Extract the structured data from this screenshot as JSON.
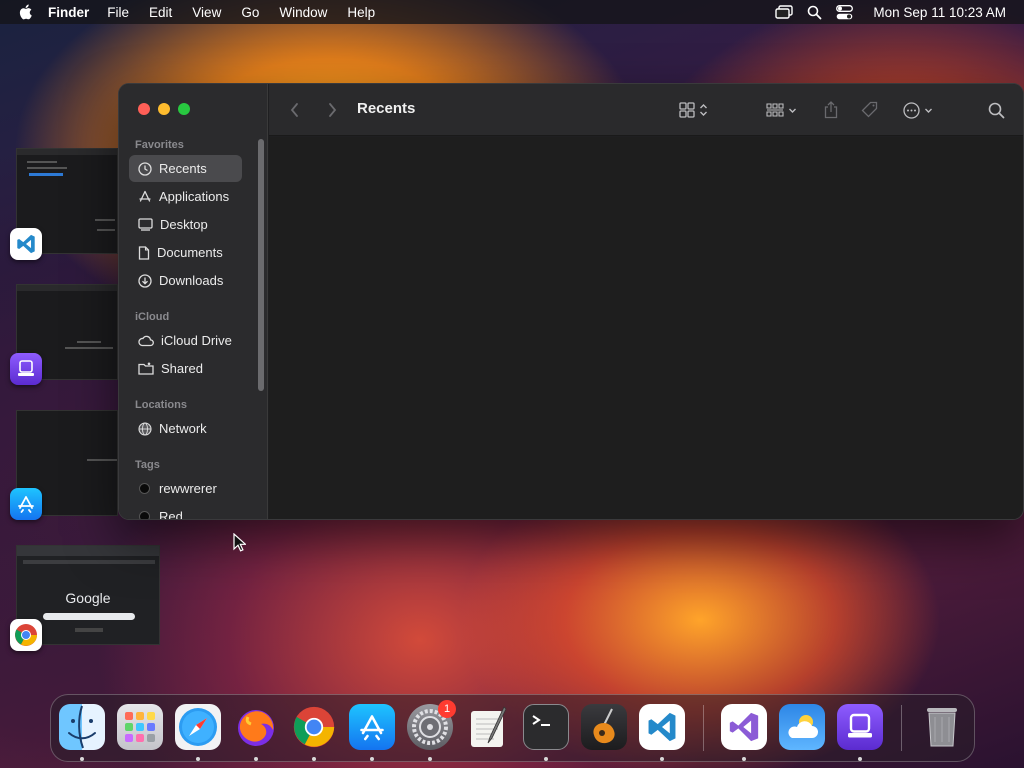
{
  "menubar": {
    "app_name": "Finder",
    "menus": [
      "File",
      "Edit",
      "View",
      "Go",
      "Window",
      "Help"
    ],
    "clock": "Mon Sep 11  10:23 AM"
  },
  "finder": {
    "title": "Recents",
    "sidebar": {
      "sections": {
        "favorites": "Favorites",
        "icloud": "iCloud",
        "locations": "Locations",
        "tags": "Tags"
      },
      "favorites": [
        "Recents",
        "Applications",
        "Desktop",
        "Documents",
        "Downloads"
      ],
      "icloud": [
        "iCloud Drive",
        "Shared"
      ],
      "locations": [
        "Network"
      ],
      "tags": [
        "rewwrerer",
        "Red"
      ]
    }
  },
  "spaces": {
    "google_logo": "Google"
  },
  "dock": {
    "apps": [
      "finder-icon",
      "launchpad-icon",
      "safari-icon",
      "firefox-icon",
      "chrome-icon",
      "app-store-icon",
      "system-settings-icon",
      "textedit-icon",
      "terminal-icon",
      "garageband-icon",
      "vscode-icon",
      "visual-studio-icon",
      "weather-icon",
      "simulator-icon",
      "trash-icon"
    ],
    "settings_badge": "1"
  },
  "colors": {
    "accent_close": "#ff5f57",
    "accent_min": "#febc2e",
    "accent_max": "#28c840",
    "badge": "#ff3b30"
  }
}
